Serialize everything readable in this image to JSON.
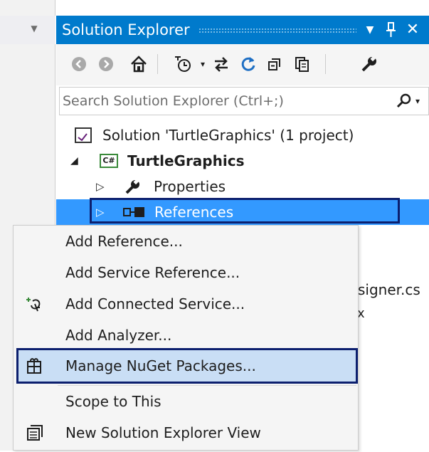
{
  "panel": {
    "title": "Solution Explorer",
    "title_buttons": [
      "dropdown-icon",
      "pin-icon",
      "close-icon"
    ]
  },
  "toolbar": {
    "icons": [
      "back-icon",
      "forward-icon",
      "home-icon",
      "pending-changes-filter-icon",
      "sync-with-active-document-icon",
      "refresh-icon",
      "collapse-all-icon",
      "show-all-files-icon",
      "properties-icon"
    ]
  },
  "search": {
    "placeholder": "Search Solution Explorer (Ctrl+;)"
  },
  "tree": {
    "solution": "Solution 'TurtleGraphics' (1 project)",
    "project": "TurtleGraphics",
    "properties": "Properties",
    "references": "References"
  },
  "peek": {
    "designer": "signer.cs",
    "x_mark": "x"
  },
  "context_menu": {
    "items": [
      {
        "label": "Add Reference...",
        "icon": ""
      },
      {
        "label": "Add Service Reference...",
        "icon": ""
      },
      {
        "label": "Add Connected Service...",
        "icon": "connected-service-icon"
      },
      {
        "label": "Add Analyzer...",
        "icon": ""
      },
      {
        "label": "Manage NuGet Packages...",
        "icon": "nuget-icon"
      },
      {
        "label": "Scope to This",
        "icon": ""
      },
      {
        "label": "New Solution Explorer View",
        "icon": "new-view-icon"
      }
    ]
  },
  "colors": {
    "title_bar": "#007acc",
    "selection": "#3399ff",
    "menu_highlight": "#c9def5",
    "outline": "#0c1f6e"
  }
}
